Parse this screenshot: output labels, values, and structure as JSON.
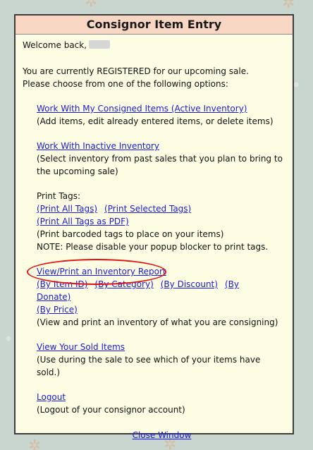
{
  "header": {
    "title": "Consignor Item Entry"
  },
  "welcome": {
    "text": "Welcome back,"
  },
  "intro": {
    "line1": "You are currently REGISTERED for our upcoming sale.",
    "line2": "Please choose from one of the following options:"
  },
  "active_inventory": {
    "link": "Work With My Consigned Items (Active Inventory)",
    "desc": "(Add items, edit already entered items, or delete items)"
  },
  "inactive_inventory": {
    "link": "Work With Inactive Inventory",
    "desc1": "(Select inventory from past sales that you plan to bring to",
    "desc2": "the upcoming sale)"
  },
  "print_tags": {
    "label": "Print Tags:",
    "all": "(Print All Tags)",
    "selected": "(Print Selected Tags)",
    "pdf": "(Print All Tags as PDF)",
    "desc": "(Print barcoded tags to place on your items)",
    "note": "NOTE: Please disable your popup blocker to print tags."
  },
  "report": {
    "link": "View/Print an Inventory Report",
    "by_item_id": "(By Item ID)",
    "by_category": "(By Category)",
    "by_discount": "(By Discount)",
    "by_donate_part1": "(By",
    "by_donate_part2": "Donate)",
    "by_price": "(By Price)",
    "desc": "(View and print an inventory of what you are consigning)"
  },
  "sold_items": {
    "link": "View Your Sold Items",
    "desc": "(Use during the sale to see which of your items have sold.)"
  },
  "logout": {
    "link": "Logout",
    "desc": "(Logout of your consignor account)"
  },
  "close": {
    "link": "Close Window"
  }
}
